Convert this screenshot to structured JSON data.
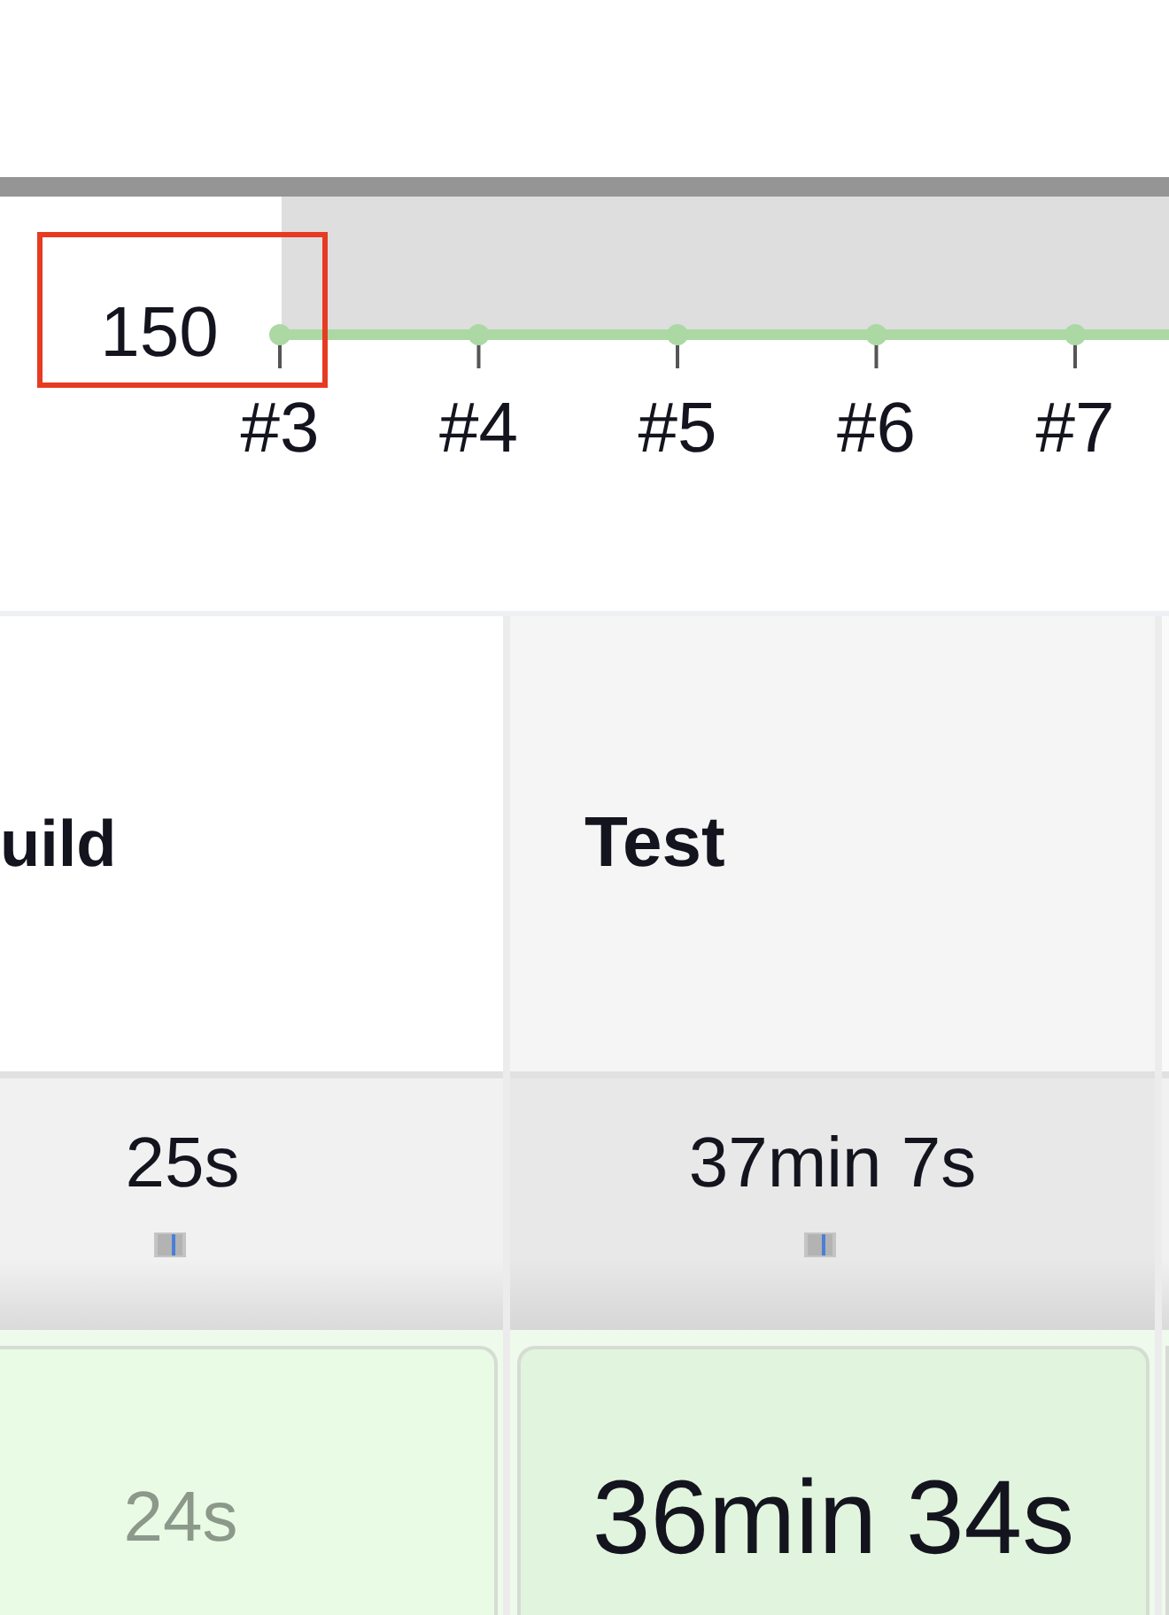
{
  "chart": {
    "y_axis": {
      "label": "150",
      "highlighted": true
    },
    "x_axis": {
      "labels": [
        "#3",
        "#4",
        "#5",
        "#6",
        "#7"
      ]
    }
  },
  "stages": [
    {
      "name": "uild",
      "average": "25s",
      "duration": "24s",
      "selected": false
    },
    {
      "name": "Test",
      "average": "37min 7s",
      "duration": "36min 34s",
      "selected": true
    }
  ]
}
